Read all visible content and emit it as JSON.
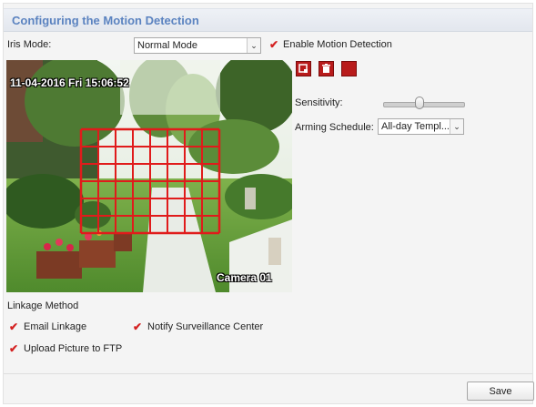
{
  "header": {
    "title": "Configuring the Motion Detection"
  },
  "iris": {
    "label": "Iris Mode:",
    "value": "Normal Mode"
  },
  "enable_motion": {
    "label": "Enable Motion Detection",
    "checked": true
  },
  "video": {
    "timestamp": "11-04-2016 Fri 15:06:52",
    "camera_name": "Camera 01",
    "grid_color": "#e01b1b",
    "grid": {
      "columns": 8,
      "rows": 6
    }
  },
  "tools": [
    {
      "name": "draw-area-icon"
    },
    {
      "name": "clear-area-icon"
    },
    {
      "name": "stop-drawing-icon"
    }
  ],
  "sensitivity": {
    "label": "Sensitivity:",
    "level": 0.45
  },
  "arming": {
    "label": "Arming Schedule:",
    "value": "All-day Templ..."
  },
  "linkage": {
    "title": "Linkage Method",
    "email": {
      "label": "Email Linkage",
      "checked": true
    },
    "notify": {
      "label": "Notify Surveillance Center",
      "checked": true
    },
    "ftp": {
      "label": "Upload Picture to FTP",
      "checked": true
    }
  },
  "actions": {
    "save_label": "Save"
  },
  "colors": {
    "accent_title": "#5b83c0",
    "checkbox_check": "#d42222",
    "tool_button": "#b81b1b"
  }
}
